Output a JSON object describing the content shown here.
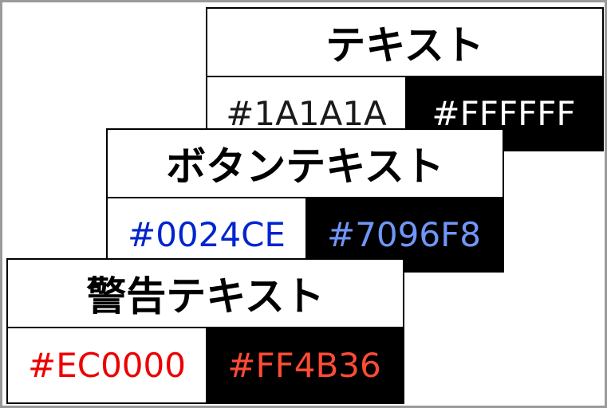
{
  "cards": [
    {
      "title": "テキスト",
      "light_value": "#1A1A1A",
      "light_color": "#1A1A1A",
      "dark_value": "#FFFFFF",
      "dark_color": "#FFFFFF"
    },
    {
      "title": "ボタンテキスト",
      "light_value": "#0024CE",
      "light_color": "#0024CE",
      "dark_value": "#7096F8",
      "dark_color": "#7096F8"
    },
    {
      "title": "警告テキスト",
      "light_value": "#EC0000",
      "light_color": "#EC0000",
      "dark_value": "#FF4B36",
      "dark_color": "#FF4B36"
    }
  ]
}
